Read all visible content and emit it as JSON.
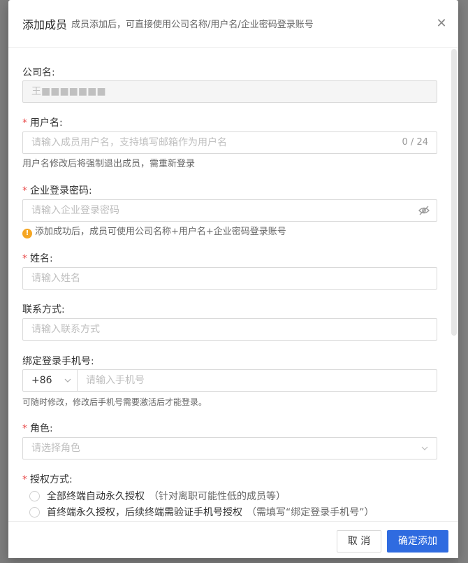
{
  "modal": {
    "title": "添加成员",
    "subtitle": "成员添加后，可直接使用公司名称/用户名/企业密码登录账号",
    "close_icon": "close-icon"
  },
  "company": {
    "label": "公司名:",
    "value": "王■■■■■■■"
  },
  "username": {
    "label": "用户名:",
    "placeholder": "请输入成员用户名，支持填写邮箱作为用户名",
    "counter": "0 / 24",
    "hint": "用户名修改后将强制退出成员，需重新登录"
  },
  "password": {
    "label": "企业登录密码:",
    "placeholder": "请输入企业登录密码",
    "hint": "添加成功后，成员可使用公司名称+用户名+企业密码登录账号"
  },
  "name": {
    "label": "姓名:",
    "placeholder": "请输入姓名"
  },
  "contact": {
    "label": "联系方式:",
    "placeholder": "请输入联系方式"
  },
  "phone": {
    "label": "绑定登录手机号:",
    "prefix": "+86",
    "placeholder": "请输入手机号",
    "hint": "可随时修改，修改后手机号需要激活后才能登录。"
  },
  "role": {
    "label": "角色:",
    "placeholder": "请选择角色"
  },
  "auth": {
    "label": "授权方式:",
    "options": [
      {
        "label": "全部终端自动永久授权",
        "note": "（针对离职可能性低的成员等）"
      },
      {
        "label": "首终端永久授权，后续终端需验证手机号授权",
        "note": "（需填写“绑定登录手机号”）"
      }
    ]
  },
  "footer": {
    "cancel_label": "取 消",
    "confirm_label": "确定添加"
  },
  "colors": {
    "primary": "#2f6be0",
    "required": "#e94b4b",
    "warning": "#f5a623"
  }
}
